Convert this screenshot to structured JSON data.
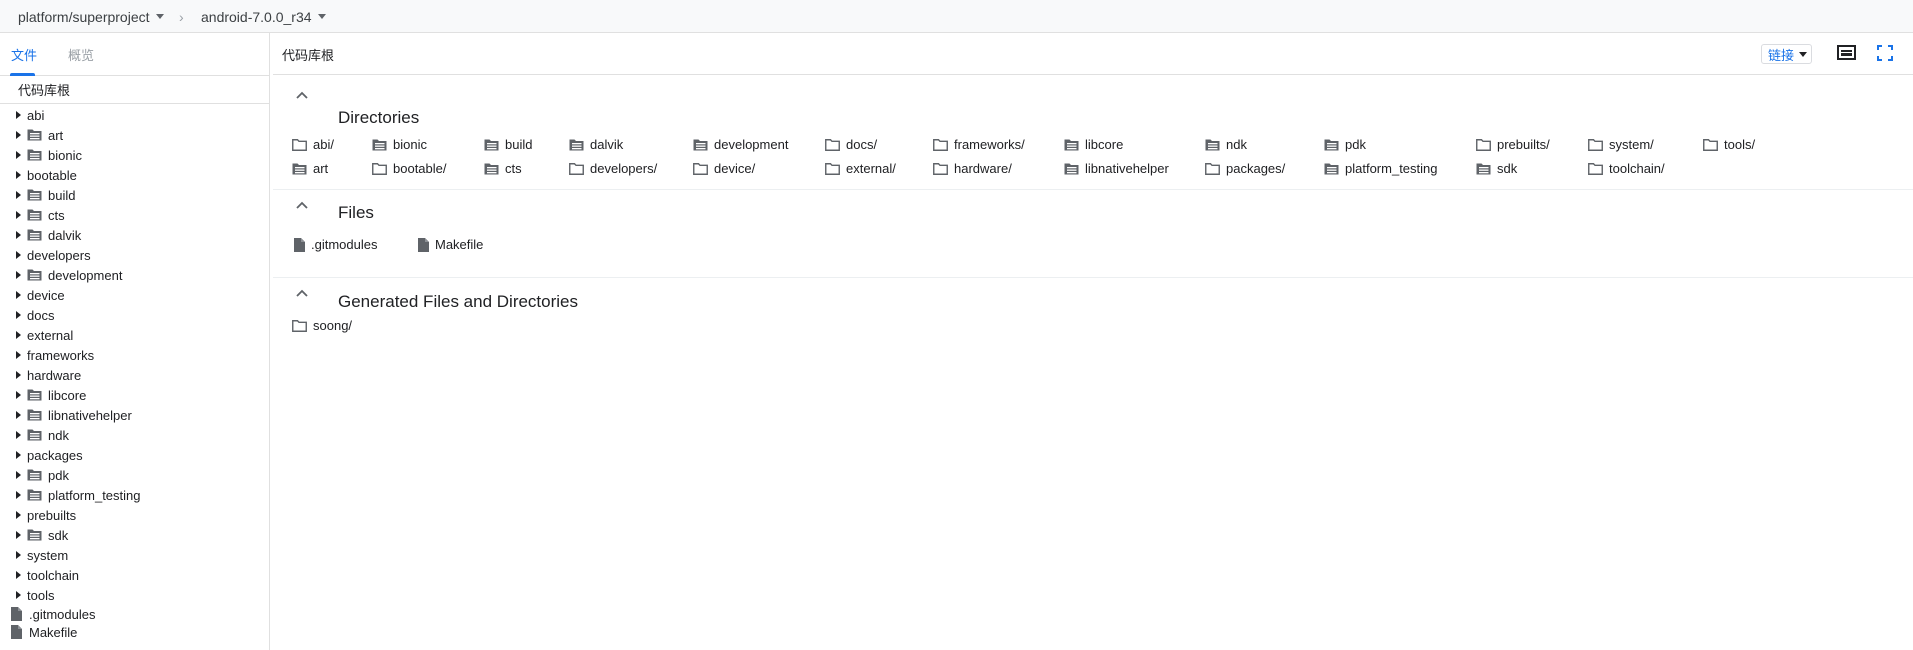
{
  "breadcrumb": {
    "project": "platform/superproject",
    "separator": "›",
    "branch": "android-7.0.0_r34"
  },
  "sidebar": {
    "tabs": [
      {
        "label": "文件",
        "active": true
      },
      {
        "label": "概览",
        "active": false
      }
    ],
    "root_label": "代码库根",
    "tree": [
      {
        "label": "abi",
        "icon": "none"
      },
      {
        "label": "art",
        "icon": "repo-folder-icon"
      },
      {
        "label": "bionic",
        "icon": "repo-folder-icon"
      },
      {
        "label": "bootable",
        "icon": "none"
      },
      {
        "label": "build",
        "icon": "repo-folder-icon"
      },
      {
        "label": "cts",
        "icon": "repo-folder-icon"
      },
      {
        "label": "dalvik",
        "icon": "repo-folder-icon"
      },
      {
        "label": "developers",
        "icon": "none"
      },
      {
        "label": "development",
        "icon": "repo-folder-icon"
      },
      {
        "label": "device",
        "icon": "none"
      },
      {
        "label": "docs",
        "icon": "none"
      },
      {
        "label": "external",
        "icon": "none"
      },
      {
        "label": "frameworks",
        "icon": "none"
      },
      {
        "label": "hardware",
        "icon": "none"
      },
      {
        "label": "libcore",
        "icon": "repo-folder-icon"
      },
      {
        "label": "libnativehelper",
        "icon": "repo-folder-icon"
      },
      {
        "label": "ndk",
        "icon": "repo-folder-icon"
      },
      {
        "label": "packages",
        "icon": "none"
      },
      {
        "label": "pdk",
        "icon": "repo-folder-icon"
      },
      {
        "label": "platform_testing",
        "icon": "repo-folder-icon"
      },
      {
        "label": "prebuilts",
        "icon": "none"
      },
      {
        "label": "sdk",
        "icon": "repo-folder-icon"
      },
      {
        "label": "system",
        "icon": "none"
      },
      {
        "label": "toolchain",
        "icon": "none"
      },
      {
        "label": "tools",
        "icon": "none"
      }
    ],
    "files": [
      {
        "label": ".gitmodules",
        "icon": "file-icon"
      },
      {
        "label": "Makefile",
        "icon": "file-icon"
      }
    ]
  },
  "main": {
    "title": "代码库根",
    "link_button": "链接",
    "sections": {
      "directories": {
        "title": "Directories",
        "row1": [
          {
            "label": "abi/",
            "icon": "folder-icon"
          },
          {
            "label": "bionic",
            "icon": "repo-folder-icon"
          },
          {
            "label": "build",
            "icon": "repo-folder-icon"
          },
          {
            "label": "dalvik",
            "icon": "repo-folder-icon"
          },
          {
            "label": "development",
            "icon": "repo-folder-icon"
          },
          {
            "label": "docs/",
            "icon": "folder-icon"
          },
          {
            "label": "frameworks/",
            "icon": "folder-icon"
          },
          {
            "label": "libcore",
            "icon": "repo-folder-icon"
          },
          {
            "label": "ndk",
            "icon": "repo-folder-icon"
          },
          {
            "label": "pdk",
            "icon": "repo-folder-icon"
          },
          {
            "label": "prebuilts/",
            "icon": "folder-icon"
          },
          {
            "label": "system/",
            "icon": "folder-icon"
          },
          {
            "label": "tools/",
            "icon": "folder-icon"
          }
        ],
        "row2": [
          {
            "label": "art",
            "icon": "repo-folder-icon"
          },
          {
            "label": "bootable/",
            "icon": "folder-icon"
          },
          {
            "label": "cts",
            "icon": "repo-folder-icon"
          },
          {
            "label": "developers/",
            "icon": "folder-icon"
          },
          {
            "label": "device/",
            "icon": "folder-icon"
          },
          {
            "label": "external/",
            "icon": "folder-icon"
          },
          {
            "label": "hardware/",
            "icon": "folder-icon"
          },
          {
            "label": "libnativehelper",
            "icon": "repo-folder-icon"
          },
          {
            "label": "packages/",
            "icon": "folder-icon"
          },
          {
            "label": "platform_testing",
            "icon": "repo-folder-icon"
          },
          {
            "label": "sdk",
            "icon": "repo-folder-icon"
          },
          {
            "label": "toolchain/",
            "icon": "folder-icon"
          }
        ]
      },
      "files": {
        "title": "Files",
        "items": [
          {
            "label": ".gitmodules",
            "icon": "file-icon"
          },
          {
            "label": "Makefile",
            "icon": "file-icon"
          }
        ]
      },
      "generated": {
        "title": "Generated Files and Directories",
        "items": [
          {
            "label": "soong/",
            "icon": "folder-icon"
          }
        ]
      }
    }
  },
  "colors": {
    "accent": "#1a73e8",
    "border": "#e0e0e0",
    "icon": "#5f6368"
  }
}
